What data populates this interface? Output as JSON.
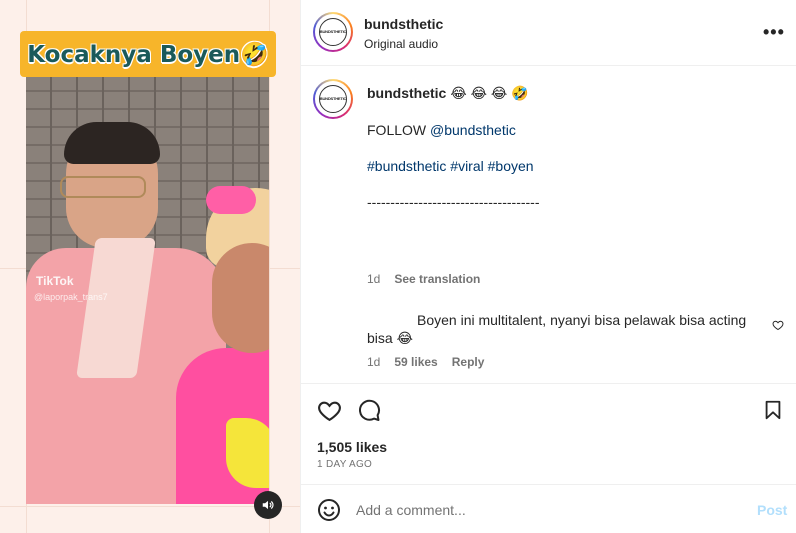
{
  "media": {
    "caption": "Kocaknya Boyen🤣",
    "watermark": "TikTok",
    "watermark_handle": "@laporpak_trans7"
  },
  "header": {
    "username": "bundsthetic",
    "subtitle": "Original audio",
    "more": "•••",
    "avatar_text": "BUNDSTHETIC"
  },
  "post": {
    "username": "bundsthetic",
    "emojis": "😂 😂 😂 🤣",
    "follow_prefix": "FOLLOW ",
    "follow_handle": "@bundsthetic",
    "hashtags": "#bundsthetic #viral #boyen",
    "divider": "-------------------------------------",
    "time": "1d",
    "see_translation": "See translation"
  },
  "reply": {
    "text": "Boyen ini multitalent, nyanyi bisa pelawak bisa acting bisa 😂",
    "time": "1d",
    "likes": "59 likes",
    "reply_label": "Reply"
  },
  "actions": {
    "likes": "1,505 likes",
    "date": "1 DAY AGO"
  },
  "comment_box": {
    "placeholder": "Add a comment...",
    "post_label": "Post"
  }
}
